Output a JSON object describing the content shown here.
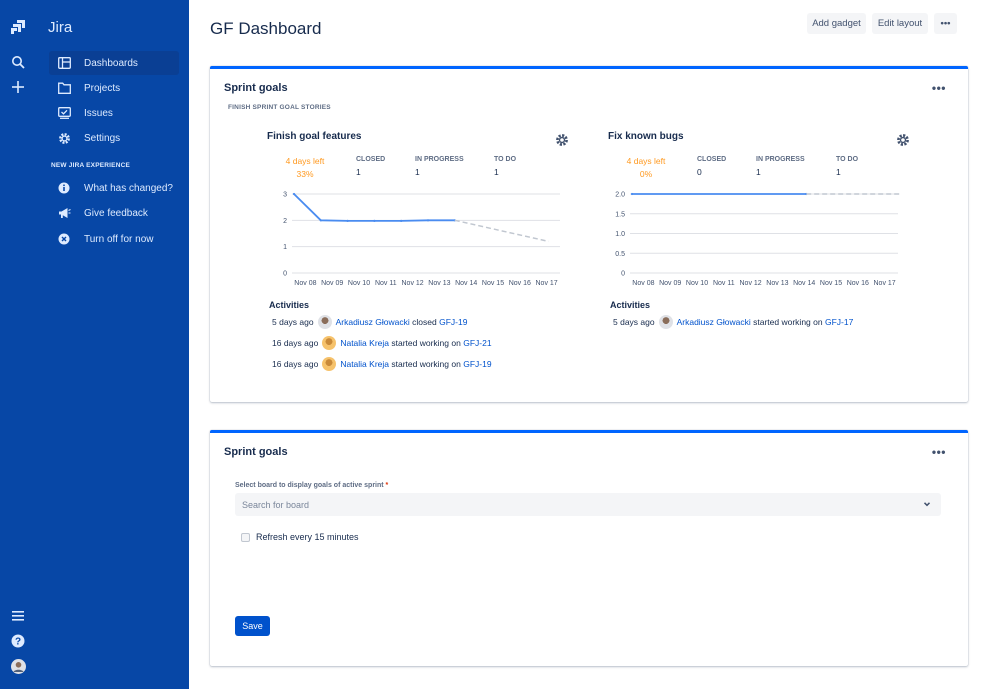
{
  "app": {
    "name": "Jira"
  },
  "sidebar": {
    "items": [
      {
        "label": "Dashboards",
        "icon": "dashboard-icon",
        "active": true
      },
      {
        "label": "Projects",
        "icon": "folder-icon"
      },
      {
        "label": "Issues",
        "icon": "issues-icon"
      },
      {
        "label": "Settings",
        "icon": "gear-icon"
      }
    ],
    "section_title": "NEW JIRA EXPERIENCE",
    "experience_items": [
      {
        "label": "What has changed?",
        "icon": "info-icon"
      },
      {
        "label": "Give feedback",
        "icon": "megaphone-icon"
      },
      {
        "label": "Turn off for now",
        "icon": "close-circle-icon"
      }
    ]
  },
  "header": {
    "title": "GF Dashboard",
    "add_gadget": "Add gadget",
    "edit_layout": "Edit layout",
    "more": "•••"
  },
  "gadget1": {
    "title": "Sprint goals",
    "more": "•••",
    "subtitle": "FINISH SPRINT GOAL STORIES",
    "goals": [
      {
        "title": "Finish goal features",
        "days_left": "4 days left",
        "percent": "33%",
        "stats": [
          {
            "label": "CLOSED",
            "value": "1"
          },
          {
            "label": "IN PROGRESS",
            "value": "1"
          },
          {
            "label": "TO DO",
            "value": "1"
          }
        ],
        "activities_title": "Activities",
        "activities": [
          {
            "time": "5 days ago",
            "user": "Arkadiusz Głowacki",
            "action": "closed",
            "issue": "GFJ-19"
          },
          {
            "time": "16 days ago",
            "user": "Natalia Kreja",
            "action": "started working on",
            "issue": "GFJ-21"
          },
          {
            "time": "16 days ago",
            "user": "Natalia Kreja",
            "action": "started working on",
            "issue": "GFJ-19"
          }
        ]
      },
      {
        "title": "Fix known bugs",
        "days_left": "4 days left",
        "percent": "0%",
        "stats": [
          {
            "label": "CLOSED",
            "value": "0"
          },
          {
            "label": "IN PROGRESS",
            "value": "1"
          },
          {
            "label": "TO DO",
            "value": "1"
          }
        ],
        "activities_title": "Activities",
        "activities": [
          {
            "time": "5 days ago",
            "user": "Arkadiusz Głowacki",
            "action": "started working on",
            "issue": "GFJ-17"
          }
        ]
      }
    ]
  },
  "gadget2": {
    "title": "Sprint goals",
    "more": "•••",
    "field_label": "Select board to display goals of active sprint",
    "required_mark": "*",
    "search_placeholder": "Search for board",
    "refresh_label": "Refresh every 15 minutes",
    "save_label": "Save"
  },
  "colors": {
    "sidebar": "#0747a6",
    "accent": "#0065ff",
    "link": "#0052cc",
    "warning": "#ff991f"
  },
  "chart_data": [
    {
      "type": "line",
      "title": "Finish goal features",
      "categories": [
        "Nov 08",
        "Nov 09",
        "Nov 10",
        "Nov 11",
        "Nov 12",
        "Nov 13",
        "Nov 14",
        "Nov 15",
        "Nov 16",
        "Nov 17"
      ],
      "yticks": [
        "0",
        "1",
        "2",
        "3"
      ],
      "ylim": [
        0,
        3
      ],
      "series": [
        {
          "style": "actual",
          "color": "#4a8cf0",
          "points": [
            [
              0,
              3
            ],
            [
              1,
              2
            ],
            [
              2,
              1.98
            ],
            [
              3,
              1.98
            ],
            [
              4,
              1.98
            ],
            [
              5,
              2
            ],
            [
              6,
              2
            ]
          ]
        },
        {
          "style": "projected",
          "color": "#c1c7d0",
          "points": [
            [
              6,
              2
            ],
            [
              9.5,
              1.2
            ]
          ]
        }
      ],
      "grid": true
    },
    {
      "type": "line",
      "title": "Fix known bugs",
      "categories": [
        "Nov 08",
        "Nov 09",
        "Nov 10",
        "Nov 11",
        "Nov 12",
        "Nov 13",
        "Nov 14",
        "Nov 15",
        "Nov 16",
        "Nov 17"
      ],
      "yticks": [
        "0",
        "0.5",
        "1.0",
        "1.5",
        "2.0"
      ],
      "ylim": [
        0,
        2
      ],
      "series": [
        {
          "style": "actual",
          "color": "#4a8cf0",
          "points": [
            [
              0,
              2
            ],
            [
              6.5,
              2
            ]
          ]
        },
        {
          "style": "projected",
          "color": "#c1c7d0",
          "points": [
            [
              6.5,
              2
            ],
            [
              10,
              2
            ]
          ]
        }
      ],
      "grid": true
    }
  ]
}
